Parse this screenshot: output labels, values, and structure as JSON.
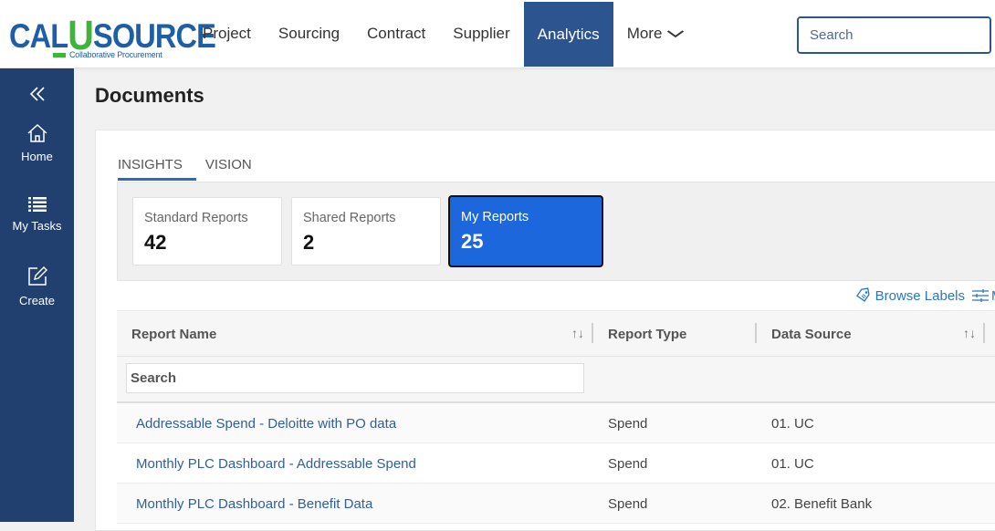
{
  "brand": {
    "name_left": "CAL",
    "name_u": "U",
    "name_right": "SOURCE",
    "tagline": "Collaborative Procurement",
    "colors": {
      "primary": "#1e5ea6",
      "accent_green": "#3cb539",
      "nav_active": "#2c5590",
      "sidebar": "#21406f",
      "tile_active": "#1c67dc",
      "link": "#2f5f9e"
    }
  },
  "nav": {
    "items": [
      {
        "label": "Project"
      },
      {
        "label": "Sourcing"
      },
      {
        "label": "Contract"
      },
      {
        "label": "Supplier"
      },
      {
        "label": "Analytics",
        "active": true
      },
      {
        "label": "More"
      }
    ]
  },
  "search": {
    "placeholder": "Search",
    "icon": "search-icon"
  },
  "sidebar": {
    "collapse_icon": "double-chevron-left-icon",
    "items": [
      {
        "label": "Home",
        "icon": "home-icon"
      },
      {
        "label": "My Tasks",
        "icon": "list-icon"
      },
      {
        "label": "Create",
        "icon": "edit-icon"
      }
    ]
  },
  "page": {
    "title": "Documents"
  },
  "tabs": [
    {
      "label": "INSIGHTS",
      "active": true
    },
    {
      "label": "VISION"
    }
  ],
  "tiles": [
    {
      "label": "Standard Reports",
      "count": "42"
    },
    {
      "label": "Shared Reports",
      "count": "2"
    },
    {
      "label": "My Reports",
      "count": "25",
      "active": true
    }
  ],
  "toolbar": {
    "browse_labels": "Browse Labels",
    "manage_label": "M"
  },
  "table": {
    "columns": [
      {
        "label": "Report Name",
        "sortable": true
      },
      {
        "label": "Report Type",
        "sortable": false
      },
      {
        "label": "Data Source",
        "sortable": true
      }
    ],
    "filter_placeholder": "Search",
    "rows": [
      {
        "name": "Addressable Spend - Deloitte with PO data",
        "type": "Spend",
        "source": "01. UC"
      },
      {
        "name": "Monthly PLC Dashboard - Addressable Spend",
        "type": "Spend",
        "source": "01. UC"
      },
      {
        "name": "Monthly PLC Dashboard - Benefit Data",
        "type": "Spend",
        "source": "02. Benefit Bank"
      }
    ]
  }
}
